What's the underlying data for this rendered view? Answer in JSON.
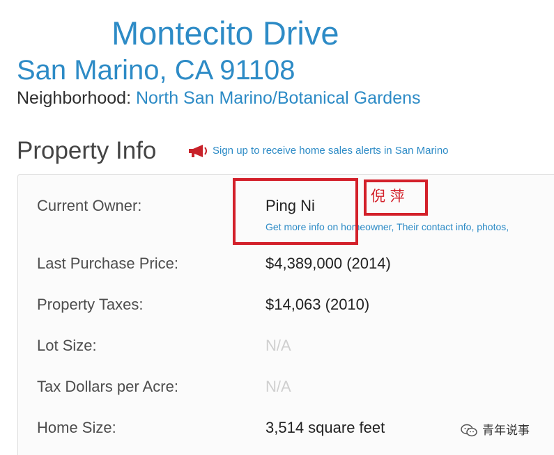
{
  "header": {
    "street": "Montecito Drive",
    "city_line": "San Marino, CA 91108",
    "neighborhood_label": "Neighborhood:",
    "neighborhood_value": "North San Marino/Botanical Gardens"
  },
  "property_info": {
    "title": "Property Info",
    "alert_link": "Sign up to receive home sales alerts in San Marino",
    "rows": [
      {
        "label": "Current Owner:",
        "value": "Ping Ni",
        "subtext": "Get more info on homeowner, Their contact info, photos,"
      },
      {
        "label": "Last Purchase Price:",
        "value": "$4,389,000 (2014)"
      },
      {
        "label": "Property Taxes:",
        "value": "$14,063 (2010)"
      },
      {
        "label": "Lot Size:",
        "value": "N/A"
      },
      {
        "label": "Tax Dollars per Acre:",
        "value": "N/A"
      },
      {
        "label": "Home Size:",
        "value": "3,514 square feet"
      }
    ]
  },
  "annotation": {
    "text": "倪 萍"
  },
  "watermark": {
    "text": "青年说事"
  },
  "colors": {
    "link_blue": "#2d8bc6",
    "annotation_red": "#d3202a",
    "muted_gray": "#cfcfcf"
  }
}
